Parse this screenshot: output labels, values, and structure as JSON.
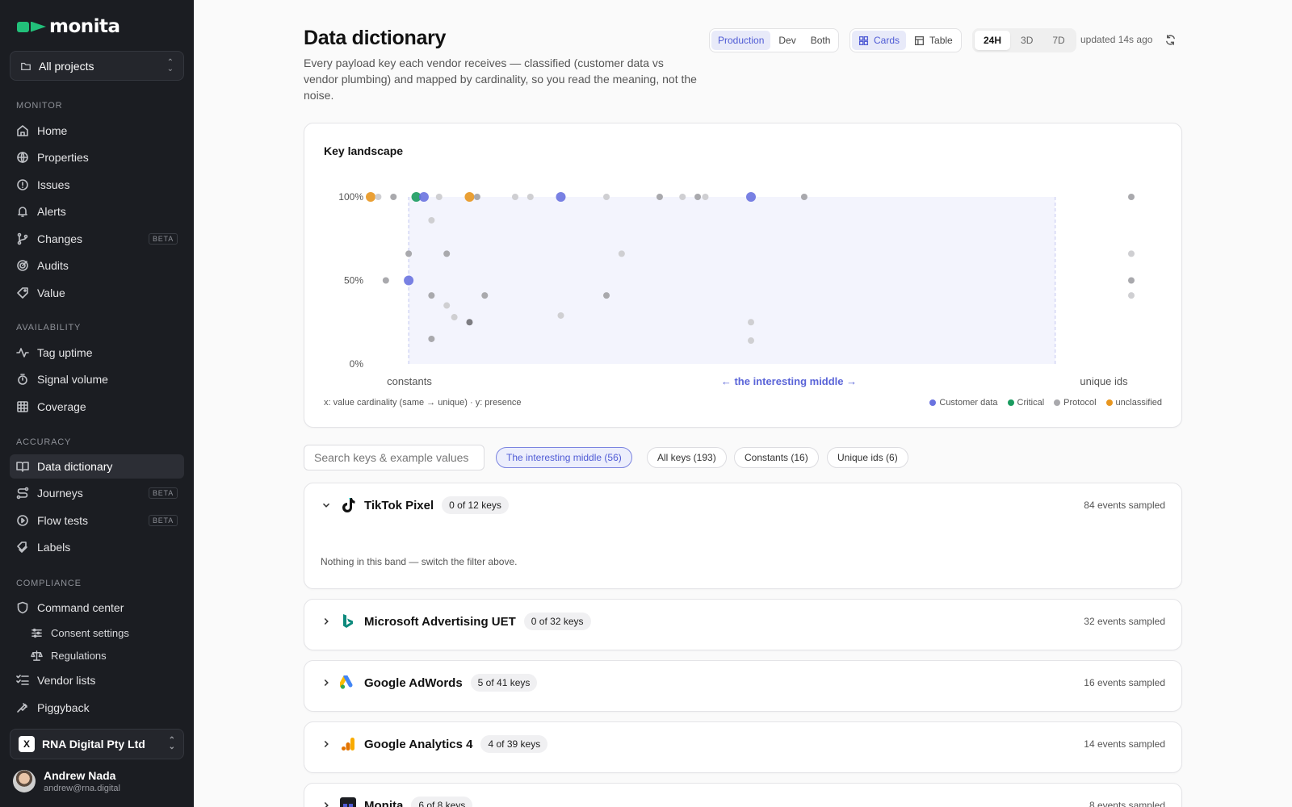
{
  "app": {
    "logo_text": "monita"
  },
  "sidebar": {
    "project_selector": "All projects",
    "sections": {
      "monitor": "MONITOR",
      "availability": "AVAILABILITY",
      "accuracy": "ACCURACY",
      "compliance": "COMPLIANCE"
    },
    "items": {
      "home": "Home",
      "properties": "Properties",
      "issues": "Issues",
      "alerts": "Alerts",
      "changes": "Changes",
      "audits": "Audits",
      "value": "Value",
      "tag_uptime": "Tag uptime",
      "signal_volume": "Signal volume",
      "coverage": "Coverage",
      "data_dictionary": "Data dictionary",
      "journeys": "Journeys",
      "flow_tests": "Flow tests",
      "labels": "Labels",
      "command_center": "Command center",
      "consent_settings": "Consent settings",
      "regulations": "Regulations",
      "vendor_lists": "Vendor lists",
      "piggyback": "Piggyback"
    },
    "beta_label": "BETA",
    "org": {
      "name": "RNA Digital Pty Ltd",
      "logo": "X"
    },
    "user": {
      "name": "Andrew Nada",
      "email": "andrew@rna.digital"
    }
  },
  "header": {
    "title": "Data dictionary",
    "description": "Every payload key each vendor receives — classified (customer data vs vendor plumbing) and mapped by cardinality, so you read the meaning, not the noise.",
    "env_options": [
      "Production",
      "Dev",
      "Both"
    ],
    "env_selected": "Production",
    "view_options": [
      "Cards",
      "Table"
    ],
    "view_selected": "Cards",
    "time_options": [
      "24H",
      "3D",
      "7D"
    ],
    "time_selected": "24H",
    "updated": "updated 14s ago"
  },
  "chart_data": {
    "type": "scatter",
    "title": "Key landscape",
    "x_scale": "value cardinality (same → unique)",
    "y_label": "presence",
    "y_ticks": [
      "100%",
      "50%",
      "0%"
    ],
    "x_ticks": [
      "constants",
      "← the interesting middle →",
      "unique ids"
    ],
    "ylim": [
      0,
      100
    ],
    "xlim": [
      0,
      100
    ],
    "caption": "x: value cardinality (same → unique) · y: presence",
    "highlight_band": [
      5,
      90
    ],
    "legend": [
      {
        "name": "Customer data",
        "color": "#6a73e0"
      },
      {
        "name": "Critical",
        "color": "#1a9b5f"
      },
      {
        "name": "Protocol",
        "color": "#a9a9ad"
      },
      {
        "name": "unclassified",
        "color": "#e8961f"
      }
    ],
    "points": [
      {
        "x": 0,
        "y": 100,
        "class": "unclassified",
        "size": "l"
      },
      {
        "x": 1,
        "y": 100,
        "class": "Protocol",
        "size": "s",
        "light": true
      },
      {
        "x": 3,
        "y": 100,
        "class": "Protocol",
        "size": "s"
      },
      {
        "x": 6,
        "y": 100,
        "class": "Critical",
        "size": "l"
      },
      {
        "x": 7,
        "y": 100,
        "class": "Customer data",
        "size": "l"
      },
      {
        "x": 9,
        "y": 100,
        "class": "Protocol",
        "size": "s",
        "light": true
      },
      {
        "x": 13,
        "y": 100,
        "class": "unclassified",
        "size": "l"
      },
      {
        "x": 14,
        "y": 100,
        "class": "Protocol",
        "size": "s"
      },
      {
        "x": 19,
        "y": 100,
        "class": "Protocol",
        "size": "s",
        "light": true
      },
      {
        "x": 21,
        "y": 100,
        "class": "Protocol",
        "size": "s",
        "light": true
      },
      {
        "x": 25,
        "y": 100,
        "class": "Customer data",
        "size": "l"
      },
      {
        "x": 31,
        "y": 100,
        "class": "Protocol",
        "size": "s",
        "light": true
      },
      {
        "x": 38,
        "y": 100,
        "class": "Protocol",
        "size": "s"
      },
      {
        "x": 41,
        "y": 100,
        "class": "Protocol",
        "size": "s",
        "light": true
      },
      {
        "x": 43,
        "y": 100,
        "class": "Protocol",
        "size": "s"
      },
      {
        "x": 44,
        "y": 100,
        "class": "Protocol",
        "size": "s",
        "light": true
      },
      {
        "x": 50,
        "y": 100,
        "class": "Customer data",
        "size": "l"
      },
      {
        "x": 57,
        "y": 100,
        "class": "Protocol",
        "size": "s"
      },
      {
        "x": 100,
        "y": 100,
        "class": "Protocol",
        "size": "s"
      },
      {
        "x": 8,
        "y": 86,
        "class": "Protocol",
        "size": "s",
        "light": true
      },
      {
        "x": 5,
        "y": 66,
        "class": "Protocol",
        "size": "s"
      },
      {
        "x": 10,
        "y": 66,
        "class": "Protocol",
        "size": "s"
      },
      {
        "x": 33,
        "y": 66,
        "class": "Protocol",
        "size": "s",
        "light": true
      },
      {
        "x": 100,
        "y": 66,
        "class": "Protocol",
        "size": "s",
        "light": true
      },
      {
        "x": 2,
        "y": 50,
        "class": "Protocol",
        "size": "s"
      },
      {
        "x": 5,
        "y": 50,
        "class": "Customer data",
        "size": "l"
      },
      {
        "x": 100,
        "y": 50,
        "class": "Protocol",
        "size": "s"
      },
      {
        "x": 8,
        "y": 41,
        "class": "Protocol",
        "size": "s"
      },
      {
        "x": 15,
        "y": 41,
        "class": "Protocol",
        "size": "s"
      },
      {
        "x": 31,
        "y": 41,
        "class": "Protocol",
        "size": "s"
      },
      {
        "x": 100,
        "y": 41,
        "class": "Protocol",
        "size": "s",
        "light": true
      },
      {
        "x": 10,
        "y": 35,
        "class": "Protocol",
        "size": "s",
        "light": true
      },
      {
        "x": 11,
        "y": 28,
        "class": "Protocol",
        "size": "s",
        "light": true
      },
      {
        "x": 25,
        "y": 29,
        "class": "Protocol",
        "size": "s",
        "light": true
      },
      {
        "x": 13,
        "y": 25,
        "class": "Protocol",
        "size": "s",
        "dark": true
      },
      {
        "x": 50,
        "y": 25,
        "class": "Protocol",
        "size": "s",
        "light": true
      },
      {
        "x": 8,
        "y": 15,
        "class": "Protocol",
        "size": "s"
      },
      {
        "x": 50,
        "y": 14,
        "class": "Protocol",
        "size": "s",
        "light": true
      }
    ]
  },
  "filters": {
    "search_placeholder": "Search keys & example values",
    "chips": [
      {
        "label": "The interesting middle (56)",
        "active": true
      },
      {
        "label": "All keys (193)",
        "active": false
      },
      {
        "label": "Constants (16)",
        "active": false
      },
      {
        "label": "Unique ids (6)",
        "active": false
      }
    ]
  },
  "vendors": [
    {
      "name": "TikTok Pixel",
      "keys": "0 of 12 keys",
      "events": "84 events sampled",
      "expanded": true,
      "empty_note": "Nothing in this band — switch the filter above.",
      "icon": "tiktok-icon"
    },
    {
      "name": "Microsoft Advertising UET",
      "keys": "0 of 32 keys",
      "events": "32 events sampled",
      "expanded": false,
      "icon": "bing-icon"
    },
    {
      "name": "Google AdWords",
      "keys": "5 of 41 keys",
      "events": "16 events sampled",
      "expanded": false,
      "icon": "google-ads-icon"
    },
    {
      "name": "Google Analytics 4",
      "keys": "4 of 39 keys",
      "events": "14 events sampled",
      "expanded": false,
      "icon": "google-analytics-icon"
    },
    {
      "name": "Monita",
      "keys": "6 of 8 keys",
      "events": "8 events sampled",
      "expanded": false,
      "icon": "monita-icon"
    }
  ]
}
